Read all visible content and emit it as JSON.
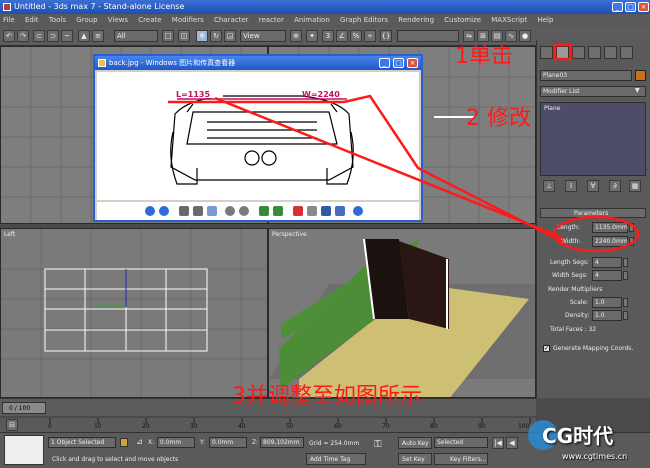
{
  "window": {
    "title": "Untitled   - 3ds max 7   - Stand-alone License",
    "controls": [
      "_",
      "□",
      "×"
    ]
  },
  "menubar": {
    "items": [
      "File",
      "Edit",
      "Tools",
      "Group",
      "Views",
      "Create",
      "Modifiers",
      "Character",
      "reactor",
      "Animation",
      "Graph Editors",
      "Rendering",
      "Customize",
      "MAXScript",
      "Help"
    ]
  },
  "toolbar": {
    "selection_filter": "All",
    "ref_coord": "View",
    "ref_coord2": "View"
  },
  "viewports": {
    "left_label": "Left",
    "perspective_label": "Perspective"
  },
  "image_viewer": {
    "title": "back.jpg - Windows 图片和传真查看器",
    "label_l": "L=1135",
    "label_w": "W=2240"
  },
  "command_panel": {
    "object_name": "Plane03",
    "object_color": "#c8701e",
    "modifier_list": "Modifier List",
    "stack_item": "Plane",
    "rollout_parameters": "Parameters",
    "length_label": "Length:",
    "length_value": "1135.0mm",
    "width_label": "Width:",
    "width_value": "2240.0mm",
    "length_segs_label": "Length Segs:",
    "length_segs_value": "4",
    "width_segs_label": "Width Segs:",
    "width_segs_value": "4",
    "render_multipliers_label": "Render Multipliers",
    "scale_label": "Scale:",
    "scale_value": "1.0",
    "density_label": "Density:",
    "density_value": "1.0",
    "total_faces": "Total Faces : 32",
    "generate_mapping": "Generate Mapping Coords."
  },
  "timeline": {
    "frame_counter": "0 / 100",
    "ticks": [
      "0",
      "10",
      "20",
      "30",
      "40",
      "50",
      "60",
      "70",
      "80",
      "90",
      "100"
    ]
  },
  "statusbar": {
    "selection": "1 Object Selected",
    "prompt": "Click and drag to select and move objects",
    "x_label": "X:",
    "x_value": "0.0mm",
    "y_label": "Y:",
    "y_value": "0.0mm",
    "z_label": "Z:",
    "z_value": "809.102mm",
    "grid": "Grid = 254.0mm",
    "add_time_tag": "Add Time Tag",
    "auto_key": "Auto Key",
    "set_key": "Set Key",
    "key_mode": "Selected",
    "key_filters": "Key Filters..."
  },
  "annotations": {
    "step1": "1单击",
    "step2": "2  修改",
    "step3": "3并调整至如图所示",
    "color": "#ff1a1a"
  },
  "watermark": {
    "logo": "CG时代",
    "url": "www.cgtimes.cn"
  }
}
